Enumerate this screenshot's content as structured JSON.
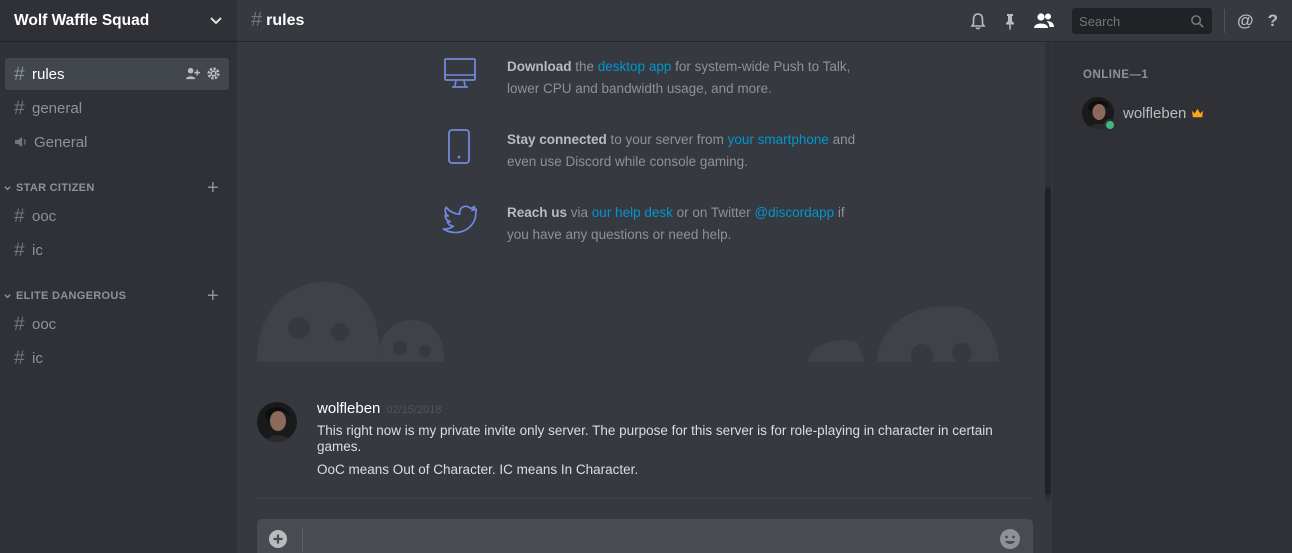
{
  "server": {
    "name": "Wolf Waffle Squad"
  },
  "channels": {
    "top": [
      {
        "name": "rules",
        "type": "text",
        "active": true
      },
      {
        "name": "general",
        "type": "text"
      },
      {
        "name": "General",
        "type": "voice"
      }
    ],
    "categories": [
      {
        "name": "STAR CITIZEN",
        "channels": [
          "ooc",
          "ic"
        ]
      },
      {
        "name": "ELITE DANGEROUS",
        "channels": [
          "ooc",
          "ic"
        ]
      }
    ]
  },
  "topbar": {
    "hash": "#",
    "channel": "rules",
    "search_placeholder": "Search",
    "mention_glyph": "@",
    "help_glyph": "?"
  },
  "features": {
    "download": {
      "bold": "Download",
      "t1": " the ",
      "link": "desktop app",
      "t2": " for system-wide Push to Talk, lower CPU and bandwidth usage, and more."
    },
    "mobile": {
      "bold": "Stay connected",
      "t1": " to your server from ",
      "link": "your smartphone",
      "t2": " and even use Discord while console gaming."
    },
    "twitter": {
      "bold": "Reach us",
      "t1": " via ",
      "link": "our help desk",
      "t2": " or on Twitter ",
      "link2": "@discordapp",
      "t3": " if you have any questions or need help."
    }
  },
  "message": {
    "author": "wolfleben",
    "timestamp": "02/15/2018",
    "line1": "This right now is my private invite only server. The purpose for this server is for role-playing in character in certain games.",
    "line2": "OoC means Out of Character. IC means In Character."
  },
  "members": {
    "group_label": "ONLINE—1",
    "list": [
      {
        "name": "wolfleben",
        "status": "online",
        "owner": true
      }
    ]
  },
  "colors": {
    "accent_link": "#0096cf",
    "online": "#43b581",
    "owner_crown": "#faa61a",
    "icon_blue": "#7289da"
  },
  "icons": [
    "chevron-down-icon",
    "hash-icon",
    "speaker-icon",
    "invite-icon",
    "gear-icon",
    "plus-icon",
    "bell-icon",
    "pin-icon",
    "members-icon",
    "search-icon",
    "at-icon",
    "help-icon",
    "monitor-icon",
    "smartphone-icon",
    "twitter-icon",
    "add-circle-icon",
    "emoji-icon",
    "crown-icon"
  ]
}
